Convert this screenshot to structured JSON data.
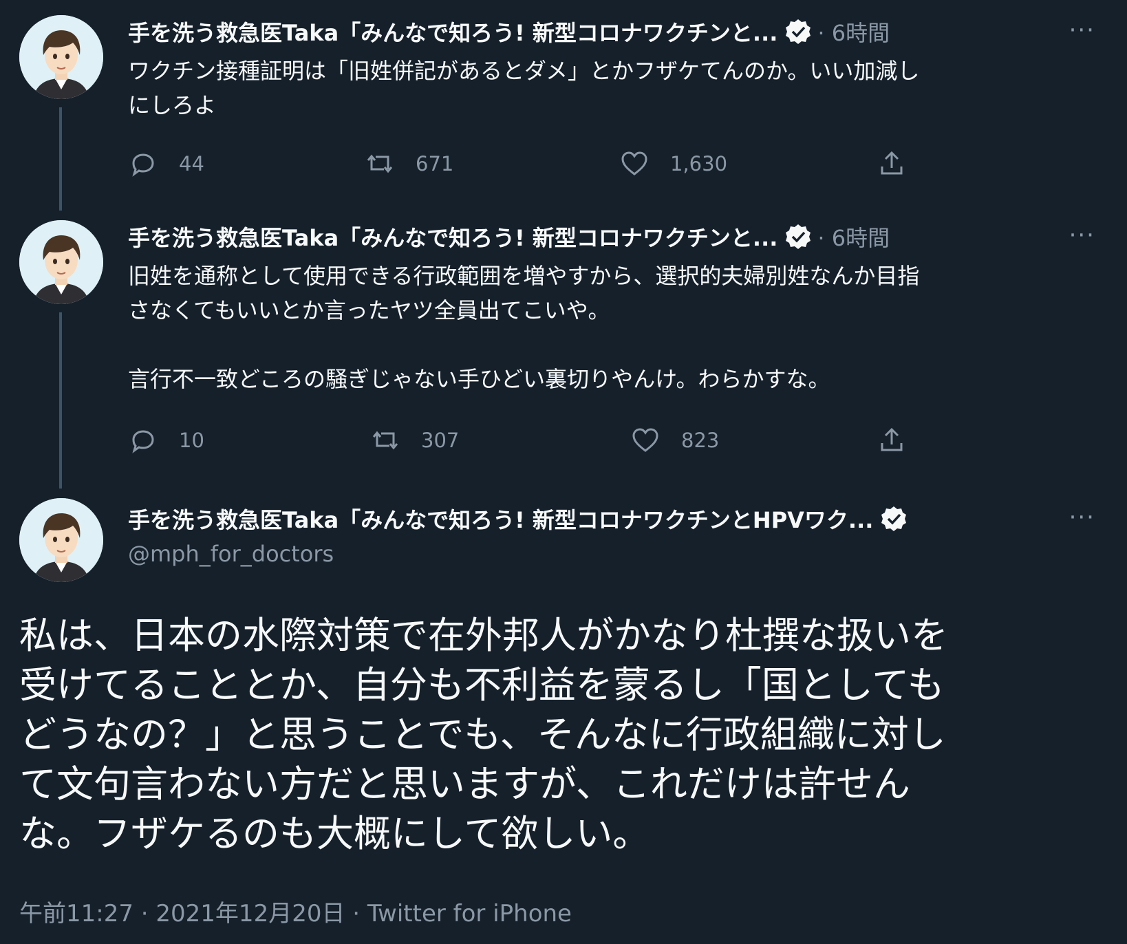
{
  "author": {
    "name_short": "手を洗う救急医Taka「みんなで知ろう! 新型コロナワクチンと...",
    "name_long": "手を洗う救急医Taka「みんなで知ろう! 新型コロナワクチンとHPVワク...",
    "handle": "@mph_for_doctors"
  },
  "tweets": [
    {
      "time": "· 6時間",
      "text": "ワクチン接種証明は「旧姓併記があるとダメ」とかフザケてんのか。いい加減し\nにしろよ",
      "replies": "44",
      "retweets": "671",
      "likes": "1,630"
    },
    {
      "time": "· 6時間",
      "text": "旧姓を通称として使用できる行政範囲を増やすから、選択的夫婦別姓なんか目指\nさなくてもいいとか言ったヤツ全員出てこいや。\n\n言行不一致どころの騒ぎじゃない手ひどい裏切りやんけ。わらかすな。",
      "replies": "10",
      "retweets": "307",
      "likes": "823"
    }
  ],
  "main_tweet": {
    "text": "私は、日本の水際対策で在外邦人がかなり杜撰な扱いを\n受けてることとか、自分も不利益を蒙るし「国としても\nどうなの？」と思うことでも、そんなに行政組織に対し\nて文句言わない方だと思いますが、これだけは許せん\nな。フザケるのも大概にして欲しい。",
    "meta": "午前11:27 · 2021年12月20日 · Twitter for iPhone"
  },
  "ui": {
    "more": "···"
  },
  "icons": {
    "reply": "reply-icon",
    "retweet": "retweet-icon",
    "like": "heart-icon",
    "share": "share-icon",
    "verified": "verified-badge-icon"
  },
  "colors": {
    "background": "#15202b",
    "text": "#f7f9f9",
    "secondary": "#8b98a5",
    "thread_line": "#3d5466"
  }
}
